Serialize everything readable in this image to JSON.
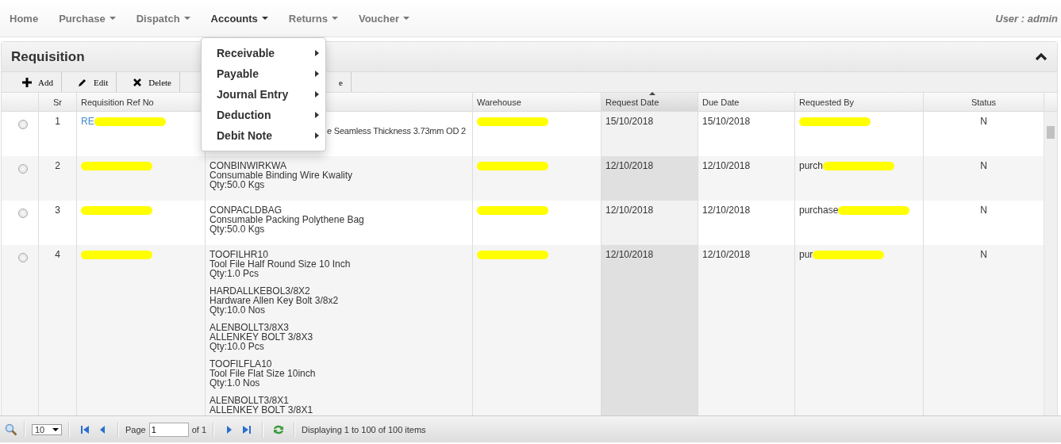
{
  "nav": {
    "items": [
      {
        "label": "Home",
        "dropdown": false,
        "selected": false
      },
      {
        "label": "Purchase",
        "dropdown": true,
        "selected": false
      },
      {
        "label": "Dispatch",
        "dropdown": true,
        "selected": false
      },
      {
        "label": "Accounts",
        "dropdown": true,
        "selected": true
      },
      {
        "label": "Returns",
        "dropdown": true,
        "selected": false
      },
      {
        "label": "Voucher",
        "dropdown": true,
        "selected": false
      }
    ],
    "user": "User : admin"
  },
  "menu": [
    {
      "label": "Receivable",
      "submenu": true
    },
    {
      "label": "Payable",
      "submenu": true
    },
    {
      "label": "Journal Entry",
      "submenu": true
    },
    {
      "label": "Deduction",
      "submenu": true
    },
    {
      "label": "Debit Note",
      "submenu": true
    }
  ],
  "panel": {
    "title": "Requisition",
    "collapsed": false
  },
  "toolbar": [
    {
      "label": "Add",
      "kind": "add"
    },
    {
      "label": "Edit",
      "kind": "edit"
    },
    {
      "label": "Delete",
      "kind": "delete"
    },
    {
      "label": "e",
      "kind": "covered"
    }
  ],
  "table": {
    "columns": [
      {
        "sorted": false
      },
      {
        "label": "Sr",
        "sorted": false
      },
      {
        "label": "Requisition Ref No",
        "sorted": false
      },
      {
        "sorted": false
      },
      {
        "label": "Warehouse",
        "sorted": false
      },
      {
        "label": "Request Date",
        "sorted": true
      },
      {
        "label": "Due Date",
        "sorted": false
      },
      {
        "label": "Requested By",
        "sorted": false
      },
      {
        "label": "Status",
        "sorted": false
      }
    ],
    "rows": [
      {
        "selected": false,
        "sr": "1",
        "ref": {
          "text": "RE",
          "redacted": true
        },
        "description": {
          "kind": "partial",
          "items": [
            [
              "e Seamless Thickness 3.73mm OD 2"
            ]
          ]
        },
        "warehouse": {
          "redacted": true
        },
        "request_date": "15/10/2018",
        "due_date": "15/10/2018",
        "requested_by": {
          "redacted": true
        },
        "status": "N"
      },
      {
        "selected": false,
        "sr": "2",
        "ref": {
          "redacted": true
        },
        "description": {
          "kind": "full",
          "items": [
            [
              "CONBINWIRKWA",
              "Consumable Binding Wire Kwality",
              "Qty:50.0 Kgs"
            ]
          ]
        },
        "warehouse": {
          "redacted": true
        },
        "request_date": "12/10/2018",
        "due_date": "12/10/2018",
        "requested_by": {
          "text": "purch",
          "redacted": true
        },
        "status": "N"
      },
      {
        "selected": false,
        "sr": "3",
        "ref": {
          "redacted": true
        },
        "description": {
          "kind": "full",
          "items": [
            [
              "CONPACLDBAG",
              "Consumable Packing Polythene Bag",
              "Qty:50.0 Kgs"
            ]
          ]
        },
        "warehouse": {
          "redacted": true
        },
        "request_date": "12/10/2018",
        "due_date": "12/10/2018",
        "requested_by": {
          "text": "purchase",
          "redacted": true
        },
        "status": "N"
      },
      {
        "selected": false,
        "sr": "4",
        "ref": {
          "redacted": true
        },
        "description": {
          "kind": "full",
          "items": [
            [
              "TOOFILHR10",
              "Tool File Half Round Size 10 Inch",
              "Qty:1.0 Pcs"
            ],
            [
              "HARDALLKEBOL3/8X2",
              "Hardware Allen Key Bolt 3/8x2",
              "Qty:10.0 Nos"
            ],
            [
              "ALENBOLLT3/8X3",
              "ALLENKEY BOLT 3/8X3",
              "Qty:10.0 Pcs"
            ],
            [
              "TOOFILFLA10",
              "Tool File Flat Size 10inch",
              "Qty:1.0 Nos"
            ],
            [
              "ALENBOLLT3/8X1",
              "ALLENKEY BOLT 3/8X1"
            ]
          ]
        },
        "warehouse": {
          "redacted": true
        },
        "request_date": "12/10/2018",
        "due_date": "12/10/2018",
        "requested_by": {
          "text": "pur",
          "redacted": true
        },
        "status": "N"
      }
    ]
  },
  "pager": {
    "page_size": "10",
    "page_label": "Page",
    "page": "1",
    "of": "of 1",
    "info": "Displaying 1 to 100 of 100 items"
  }
}
